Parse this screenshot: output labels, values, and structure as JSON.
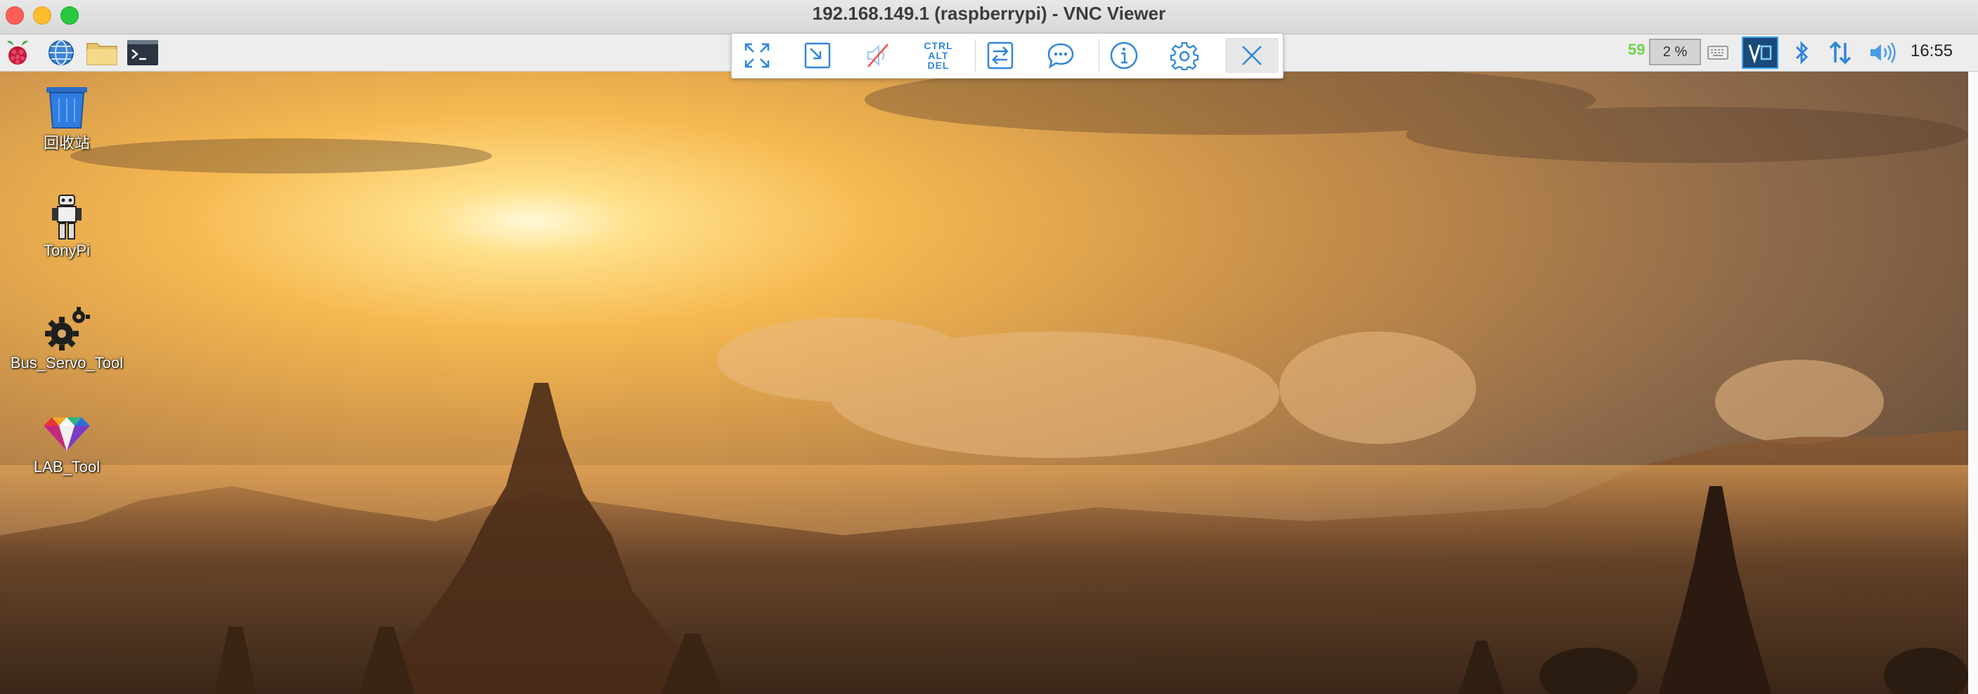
{
  "window": {
    "title": "192.168.149.1 (raspberrypi) - VNC Viewer"
  },
  "panel": {
    "launchers": [
      {
        "name": "raspberry-menu-icon"
      },
      {
        "name": "web-browser-icon"
      },
      {
        "name": "file-manager-icon"
      },
      {
        "name": "terminal-icon"
      }
    ],
    "cpu_temp": "59",
    "cpu_usage": "2 %",
    "clock": "16:55"
  },
  "vnc_toolbar": {
    "buttons": [
      {
        "name": "fullscreen-icon"
      },
      {
        "name": "scale-icon"
      },
      {
        "name": "audio-muted-icon"
      },
      {
        "name": "ctrl-alt-del-icon",
        "lines": [
          "CTRL",
          "ALT",
          "DEL"
        ]
      },
      {
        "name": "file-transfer-icon"
      },
      {
        "name": "chat-icon"
      },
      {
        "name": "info-icon"
      },
      {
        "name": "settings-gear-icon"
      },
      {
        "name": "close-icon"
      }
    ],
    "accent": "#2f86dc"
  },
  "desktop": {
    "icons": [
      {
        "label": "回收站",
        "name": "trash-icon"
      },
      {
        "label": "TonyPi",
        "name": "robot-icon"
      },
      {
        "label": "Bus_Servo_Tool",
        "name": "gears-icon"
      },
      {
        "label": "LAB_Tool",
        "name": "gem-icon"
      }
    ]
  }
}
